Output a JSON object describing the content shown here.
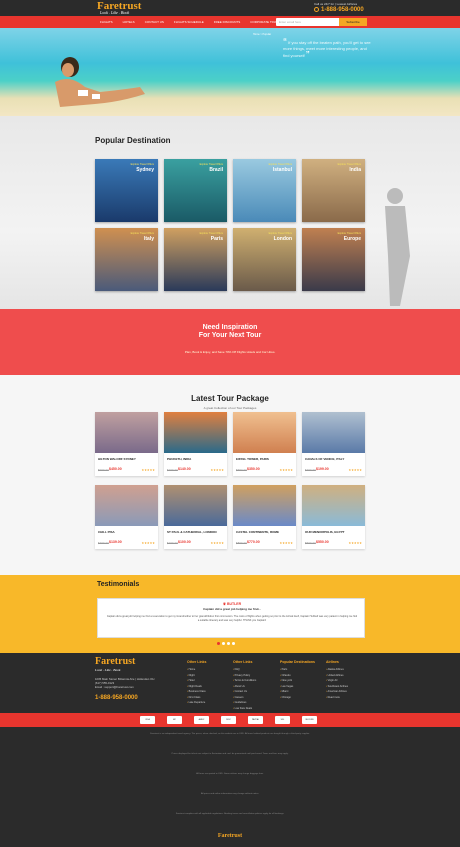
{
  "header": {
    "logo": "Faretrust",
    "tagline": "Look . Like . Book",
    "callus": "Call us 24/7 for | Lowest Airfares",
    "phone": "1-888-958-0000"
  },
  "nav": {
    "items": [
      "FLIGHTS",
      "HOTELS",
      "CONTACT US",
      "FLIGHTS SCHEDULE",
      "FREE DISCOUNTS",
      "CORPORATE TRAVELS"
    ],
    "subscribe_placeholder": "Enter email here",
    "subscribe_button": "Subscribe"
  },
  "hero": {
    "breadcrumb": "Home > Popular",
    "quote": "If you stay off the beaten path, you'll get to see more things, meet more interesting people, and find yourself"
  },
  "popular": {
    "title": "Popular Destination",
    "items": [
      {
        "tag": "Explore Travel Offers",
        "name": "Sydney",
        "c1": "#1a3a6b",
        "c2": "#3a7ab8"
      },
      {
        "tag": "Explore Travel Offers",
        "name": "Brazil",
        "c1": "#1a5a66",
        "c2": "#3aa0a0"
      },
      {
        "tag": "Explore Travel Offers",
        "name": "Istanbul",
        "c1": "#4a8ab8",
        "c2": "#9acae0"
      },
      {
        "tag": "Explore Travel Offers",
        "name": "India",
        "c1": "#8a6a4a",
        "c2": "#d0b080"
      },
      {
        "tag": "Explore Travel Offers",
        "name": "Italy",
        "c1": "#4a5a7a",
        "c2": "#d09050"
      },
      {
        "tag": "Explore Travel Offers",
        "name": "Paris",
        "c1": "#2a3a5a",
        "c2": "#d0a060"
      },
      {
        "tag": "Explore Travel Offers",
        "name": "London",
        "c1": "#6a5a4a",
        "c2": "#d0b070"
      },
      {
        "tag": "Explore Travel Offers",
        "name": "Europe",
        "c1": "#3a3a4a",
        "c2": "#c08050"
      }
    ]
  },
  "inspire": {
    "title1": "Need Inspiration",
    "title2": "For Your Next Tour",
    "sub": "Plan, Book & Enjoy, and Save 70% Off Flights Hotels and Car Hires."
  },
  "latest": {
    "title": "Latest Tour Package",
    "subtitle": "A great Collection of our Tour Packages",
    "cards": [
      {
        "title": "HILTON WALORF SYDNEY",
        "old": "$999.00",
        "price": "$450.00",
        "c1": "#7a6a8a",
        "c2": "#c0a0a0"
      },
      {
        "title": "PHUKETH, INDIA",
        "old": "$299.00",
        "price": "$140.00",
        "c1": "#2a6a8a",
        "c2": "#e08040"
      },
      {
        "title": "EIFFEL TOWER, PARIS",
        "old": "$650.00",
        "price": "$350.00",
        "c1": "#d08050",
        "c2": "#f0c090"
      },
      {
        "title": "CANALS OF VENICE, ITALY",
        "old": "$399.00",
        "price": "$199.00",
        "c1": "#5a7aa8",
        "c2": "#b0c0d0"
      },
      {
        "title": "CHILL PISA",
        "old": "$399.00",
        "price": "$139.00",
        "c1": "#8a9ab8",
        "c2": "#d0a090"
      },
      {
        "title": "ST PAUL & CATHEDRAL, LONDON",
        "old": "$299.00",
        "price": "$100.00",
        "c1": "#4a6a9a",
        "c2": "#b09070"
      },
      {
        "title": "CASTEL CONTINENTE, ROME",
        "old": "$899.00",
        "price": "$770.00",
        "c1": "#6a8ac8",
        "c2": "#d0a060"
      },
      {
        "title": "OUR MENORPOLIS, EGYPT",
        "old": "$599.00",
        "price": "$550.00",
        "c1": "#8abad8",
        "c2": "#d0b080"
      }
    ],
    "stars": "★★★★★"
  },
  "testimonials": {
    "title": "Testimonials",
    "name": "♛ BUTLER",
    "subtitle": "Captain did a great job helping me find...",
    "text": "Captain did a great job helping me find a reservation to get my Grandmother to her grandchildren first communion. The costs of flights when getting so prior to the Arrival itself, Captain Hubbell was very patient in helping me find a suitable itinerary and was very helpful. THANK you Captain!"
  },
  "footer": {
    "logo": "Faretrust",
    "tagline": "Look . Like . Book",
    "address": "1005 Main Stoner Britannia Aire | Hollenden OH",
    "fax": "(617) 555-0123",
    "email": "Email : support@Faretrust.com",
    "phone": "1-888-958-0000",
    "cols": [
      {
        "title": "Other Links",
        "items": [
          "Home",
          "Flight",
          "Hotel",
          "Flight Deals",
          "Business Class",
          "First Class",
          "Late Departure"
        ]
      },
      {
        "title": "Other Links",
        "items": [
          "FAQ",
          "Privacy Policy",
          "Terms & Conditions",
          "About Us",
          "Contact Us",
          "Careers",
          "Guidelines",
          "Low Fare Deals"
        ]
      },
      {
        "title": "Popular Destinations",
        "items": [
          "Paris",
          "Orlando",
          "New york",
          "Las Vegas",
          "Miami",
          "Chicago"
        ]
      },
      {
        "title": "Airlines",
        "items": [
          "Alaska Airlines",
          "United Airlines",
          "Virgin Air",
          "Southwest Airlines",
          "American Airlines",
          "Read more"
        ]
      }
    ],
    "payments": [
      "VISA",
      "MC",
      "AMEX",
      "DISC",
      "PAYPAL",
      "SSL",
      "SECURE"
    ],
    "legal": [
      "Faretrust is an independent travel agency. The prices, when checked, on this website are in USD. All travel related products are bought through a third-party supplier.",
      "Prices displayed for tickets are subject to fluctuation and can't be guaranteed until purchased. Taxes and fees may apply.",
      "All fares are quoted in USD. Some airlines may charge baggage fees.",
      "All prices and airline information may change without notice.",
      "Faretrust complies with all applicable regulations. Booking terms and cancellation policies apply for all bookings."
    ]
  }
}
